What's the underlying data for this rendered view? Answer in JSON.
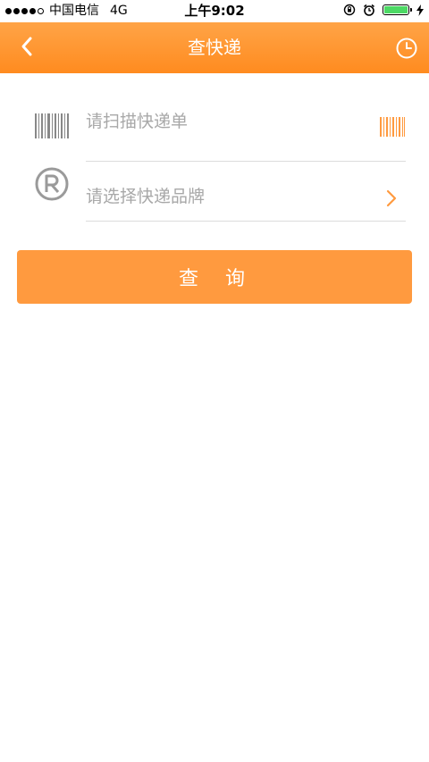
{
  "status_bar": {
    "carrier": "中国电信",
    "network": "4G",
    "time": "上午9:02"
  },
  "nav": {
    "title": "查快递",
    "back_icon": "chevron-left-icon",
    "history_icon": "clock-icon"
  },
  "form": {
    "scan": {
      "placeholder": "请扫描快递单",
      "icon": "barcode-icon",
      "action_icon": "barcode-scan-icon"
    },
    "brand": {
      "placeholder": "请选择快递品牌",
      "icon": "registered-icon",
      "action_icon": "chevron-right-icon"
    }
  },
  "query_button": {
    "label": "查询"
  },
  "colors": {
    "accent": "#ff9a3f",
    "nav_top": "#ffa447",
    "nav_bottom": "#ff8b1f",
    "battery": "#4cd964"
  }
}
